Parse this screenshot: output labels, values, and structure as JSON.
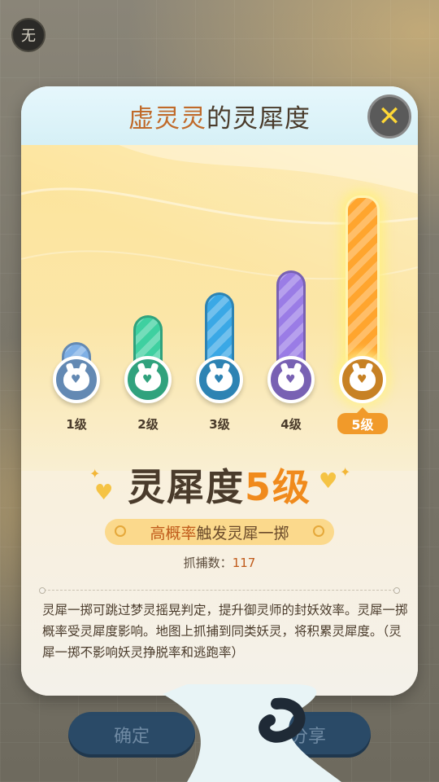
{
  "background": {
    "corner_badge": "无",
    "confirm_label": "确定",
    "share_label": "分享"
  },
  "dialog": {
    "title_pet": "虚灵灵",
    "title_rest": "的灵犀度",
    "close_icon": "close-x-icon",
    "levels": [
      {
        "label": "1级",
        "color": "#7fb0e6",
        "fill": 0.18
      },
      {
        "label": "2级",
        "color": "#3ed0a0",
        "fill": 0.33
      },
      {
        "label": "3级",
        "color": "#3aa8e6",
        "fill": 0.46
      },
      {
        "label": "4级",
        "color": "#9a7ce6",
        "fill": 0.58
      },
      {
        "label": "5级",
        "color": "#ffa52e",
        "fill": 1.0
      }
    ],
    "current_level_label": "5级",
    "big_prefix": "灵犀度",
    "big_level": "5级",
    "trigger_highlight": "高概率",
    "trigger_rest": "触发灵犀一掷",
    "catch_label": "抓捕数：",
    "catch_count": "117",
    "description": "灵犀一掷可跳过梦灵摇晃判定，提升御灵师的封妖效率。灵犀一掷概率受灵犀度影响。地图上抓捕到同类妖灵，将积累灵犀度。（灵犀一掷不影响妖灵挣脱率和逃跑率）"
  },
  "colors": {
    "accent_orange": "#f08a1c",
    "title_brown": "#4a3b2b",
    "highlight": "#c05a1a"
  }
}
